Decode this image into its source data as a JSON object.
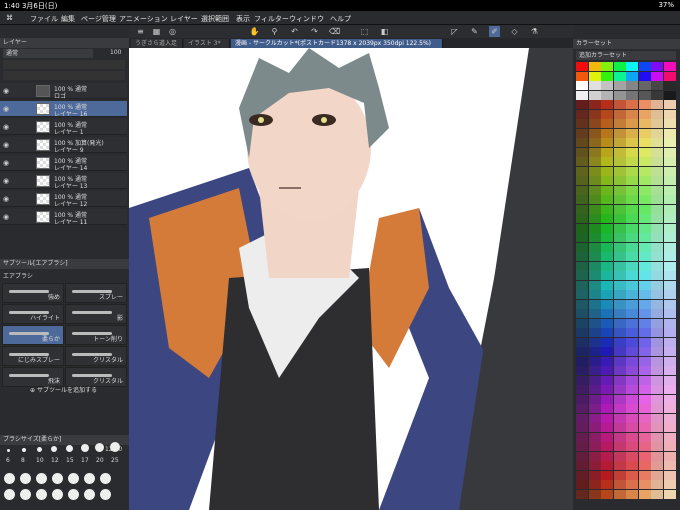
{
  "status": {
    "time": "1:40",
    "date": "3月6日(日)",
    "battery": "37%"
  },
  "menu": {
    "items": [
      "ファイル",
      "編集",
      "ページ管理",
      "アニメーション",
      "レイヤー",
      "選択範囲",
      "表示",
      "フィルター",
      "ウィンドウ",
      "ヘルプ"
    ]
  },
  "tabs": [
    {
      "label": "うぎさら道入足"
    },
    {
      "label": "イラスト 3*"
    },
    {
      "label": "漫画 - サークルカット*(ポストカード1378 x 2039px 350dpi 122.5%)"
    }
  ],
  "layers_panel": {
    "title": "レイヤー",
    "blend": "通常",
    "opacity": "100"
  },
  "layers": [
    {
      "pct": "100 %",
      "mode": "通常",
      "name": "ロゴ"
    },
    {
      "pct": "100 %",
      "mode": "通常",
      "name": "レイヤー 16"
    },
    {
      "pct": "100 %",
      "mode": "通常",
      "name": "レイヤー 1"
    },
    {
      "pct": "100 %",
      "mode": "加算(発光)",
      "name": "レイヤー 9"
    },
    {
      "pct": "100 %",
      "mode": "通常",
      "name": "レイヤー 14"
    },
    {
      "pct": "100 %",
      "mode": "通常",
      "name": "レイヤー 13"
    },
    {
      "pct": "100 %",
      "mode": "通常",
      "name": "レイヤー 12"
    },
    {
      "pct": "100 %",
      "mode": "通常",
      "name": "レイヤー 11"
    }
  ],
  "subtool": {
    "title": "サブツール[エアブラシ]",
    "group": "エアブラシ",
    "brushes": [
      "強め",
      "スプレー",
      "ハイライト",
      "影",
      "柔らか",
      "トーン削り",
      "にじみスプレー",
      "クリスタル",
      "飛沫",
      "クリスタル"
    ],
    "add": "サブツールを追加する"
  },
  "brushsize": {
    "title": "ブラシサイズ[柔らか]",
    "value": "120.0",
    "sizes": [
      "6",
      "8",
      "10",
      "12",
      "15",
      "17",
      "20",
      "25"
    ]
  },
  "color_set": {
    "title": "カラーセット",
    "name": "追加カラーセット"
  }
}
